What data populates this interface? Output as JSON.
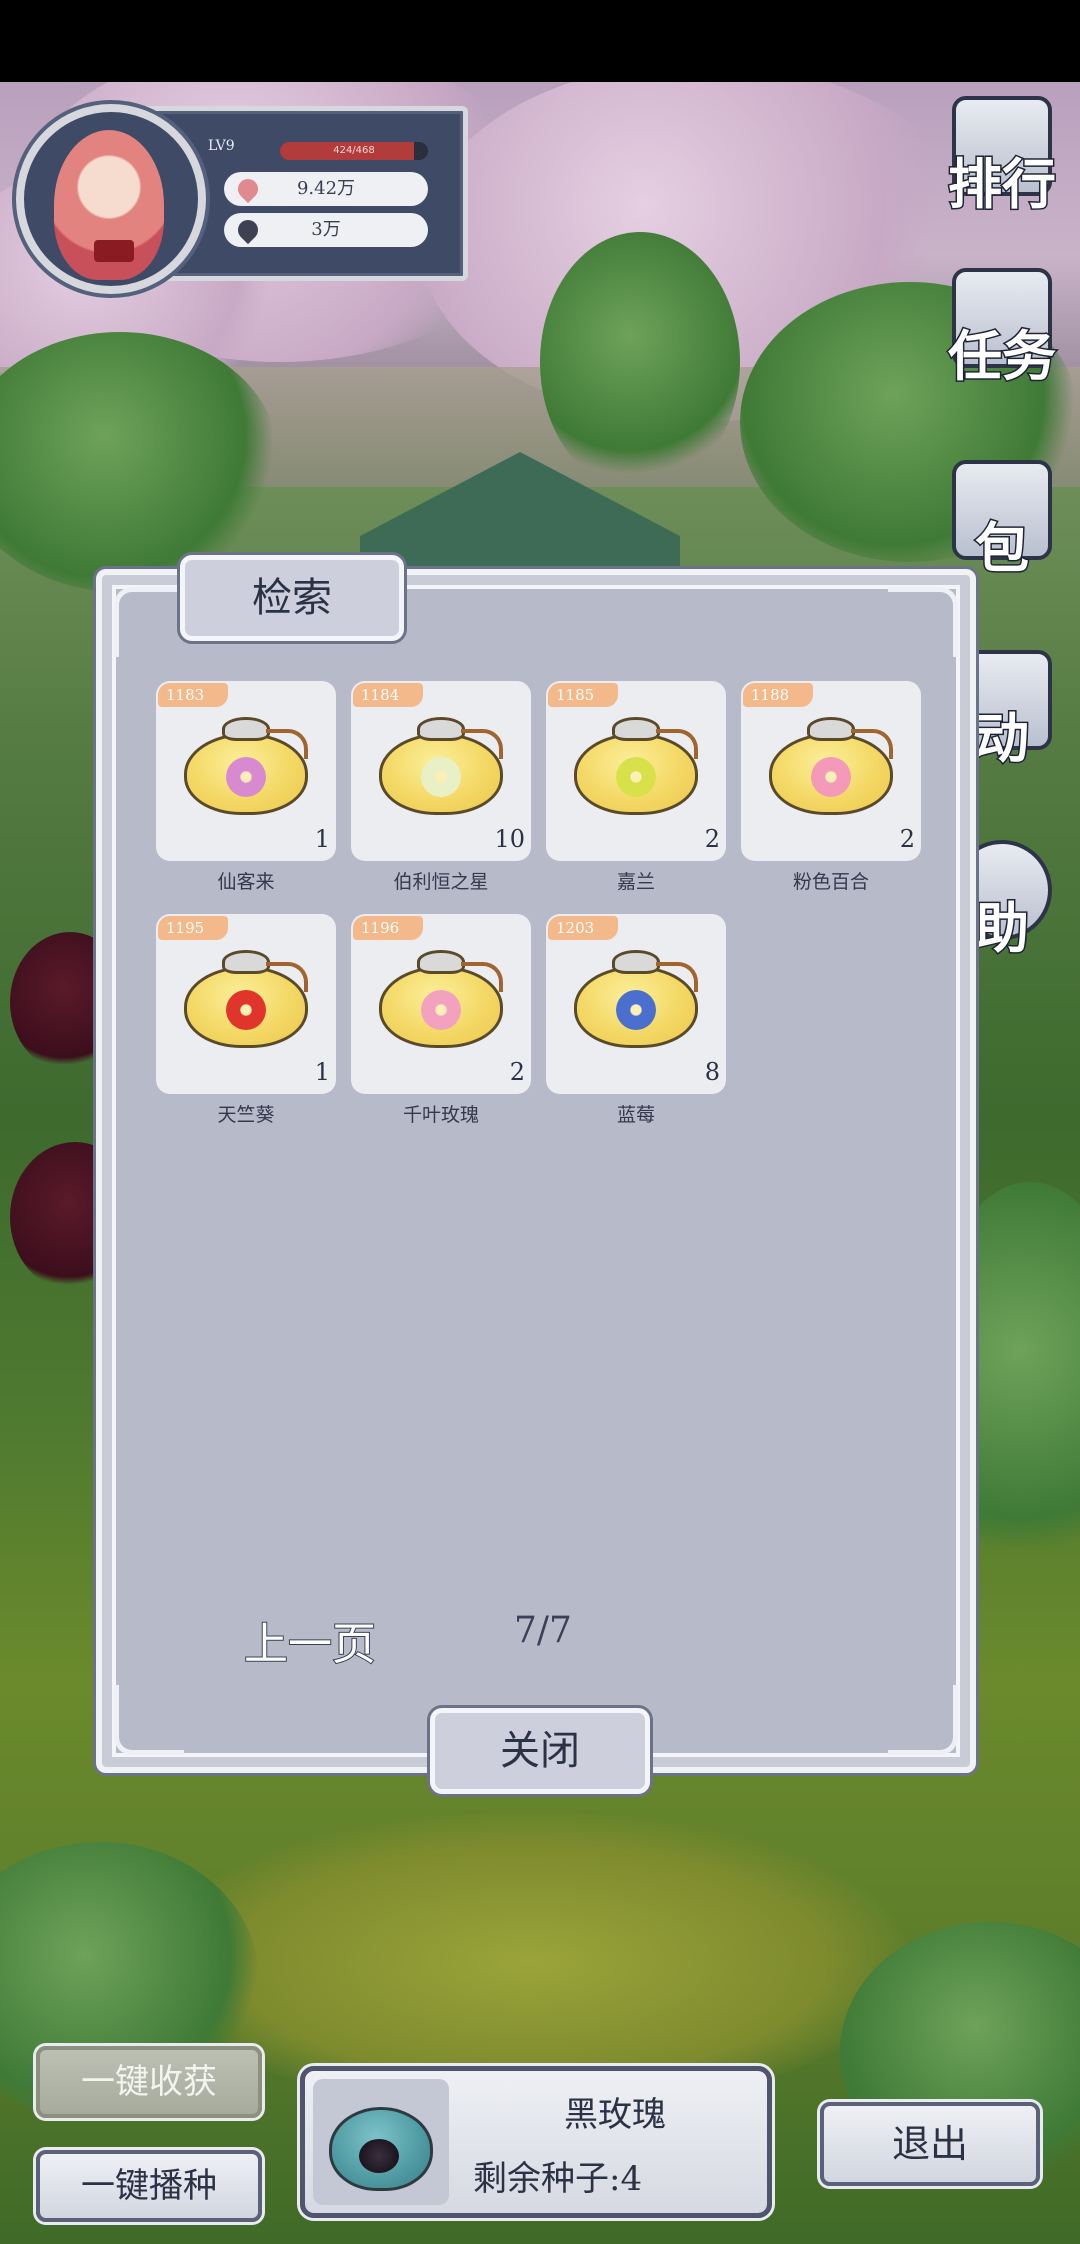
{
  "player": {
    "level": "LV9",
    "exp_text": "424/468",
    "exp_fraction": 0.906,
    "currency_1": "9.42万",
    "currency_2": "3万"
  },
  "side_nav": [
    {
      "label": "排行",
      "icon": "ranking-icon"
    },
    {
      "label": "任务",
      "icon": "task-icon"
    },
    {
      "label": "包",
      "icon": "gift-icon"
    },
    {
      "label": "动",
      "icon": "event-icon"
    },
    {
      "label": "助",
      "icon": "help-icon"
    }
  ],
  "modal": {
    "title": "检索",
    "prev_page": "上一页",
    "page_indicator": "7/7",
    "close": "关闭"
  },
  "seeds": [
    {
      "code": "1183",
      "name": "仙客来",
      "qty": "1",
      "flower_color": "#d78ad0"
    },
    {
      "code": "1184",
      "name": "伯利恒之星",
      "qty": "10",
      "flower_color": "#e9f0c6"
    },
    {
      "code": "1185",
      "name": "嘉兰",
      "qty": "2",
      "flower_color": "#d8e04a"
    },
    {
      "code": "1188",
      "name": "粉色百合",
      "qty": "2",
      "flower_color": "#f39ab8"
    },
    {
      "code": "1195",
      "name": "天竺葵",
      "qty": "1",
      "flower_color": "#e0352b"
    },
    {
      "code": "1196",
      "name": "千叶玫瑰",
      "qty": "2",
      "flower_color": "#f2a2bf"
    },
    {
      "code": "1203",
      "name": "蓝莓",
      "qty": "8",
      "flower_color": "#4a6fcf"
    }
  ],
  "bottom": {
    "harvest_all": "一键收获",
    "sow_all": "一键播种",
    "selected_seed_name": "黑玫瑰",
    "selected_seed_left": "剩余种子:4",
    "exit": "退出"
  },
  "colors": {
    "panel_bg": "#b7bbc9",
    "card_bg": "#ecedf1",
    "badge": "#f3b98a",
    "frame": "#f1f2f6"
  }
}
